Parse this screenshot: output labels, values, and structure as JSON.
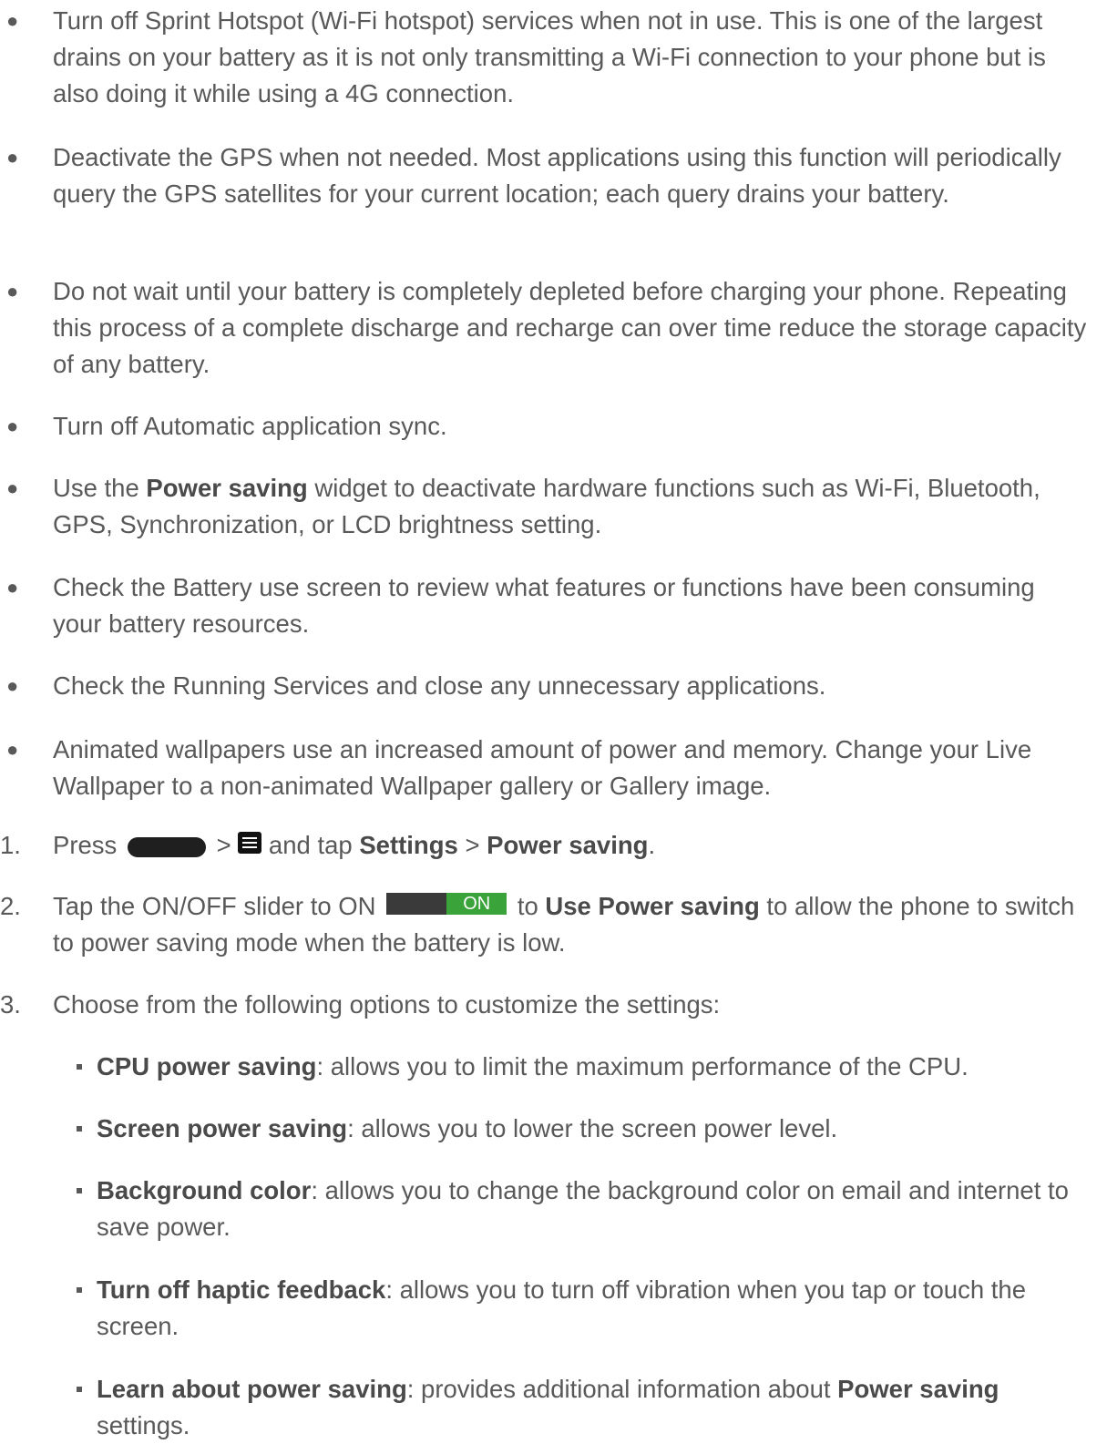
{
  "bullets": [
    "Turn off Sprint Hotspot (Wi-Fi hotspot) services when not in use. This is one of the largest drains on your battery as it is not only transmitting a Wi-Fi connection to your phone but is also doing it while using a 4G connection.",
    "Deactivate the GPS when not needed. Most applications using this function will periodically query the GPS satellites for your current location; each query drains your battery.",
    "Do not wait until your battery is completely depleted before charging your phone. Repeating this process of a complete discharge and recharge can over time reduce the storage capacity of any battery.",
    "Turn off Automatic application sync.",
    {
      "pre": "Use the ",
      "bold": "Power saving",
      "post": " widget to deactivate hardware functions such as Wi-Fi, Bluetooth, GPS, Synchronization, or LCD brightness setting."
    },
    "Check the Battery use screen to review what features or functions have been consuming your battery resources.",
    "Check the Running Services and close any unnecessary applications.",
    "Animated wallpapers use an increased amount of power and memory. Change your Live Wallpaper to a non-animated Wallpaper gallery or Gallery image."
  ],
  "bullet_glyph": "●",
  "steps": {
    "s1": {
      "num": "1.",
      "press": "Press",
      "gt1": ">",
      "and_tap": "and tap",
      "settings": "Settings",
      "gt2": ">",
      "power_saving": "Power saving",
      "end": "."
    },
    "s2": {
      "num": "2.",
      "pre": "Tap the ON/OFF slider to ON",
      "toggle_label": "ON",
      "to": "to",
      "bold": "Use Power saving",
      "post": "to allow the phone to switch to power saving mode when the battery is low."
    },
    "s3": {
      "num": "3.",
      "text": "Choose from the following options to customize the settings:"
    }
  },
  "options": [
    {
      "bold": "CPU power saving",
      "text": ": allows you to limit the maximum performance of the CPU."
    },
    {
      "bold": "Screen power saving",
      "text": ": allows you to lower the screen power level."
    },
    {
      "bold": "Background color",
      "text": ": allows you to change the background color on email and internet to save power."
    },
    {
      "bold": "Turn off haptic feedback",
      "text": ": allows you to turn off vibration when you tap or touch the screen."
    },
    {
      "bold": "Learn about power saving",
      "text": ": provides additional information about ",
      "bold2": "Power saving",
      "text2": " settings."
    }
  ],
  "icons": {
    "home": "home-key-icon",
    "menu": "menu-key-icon",
    "toggle": "on-off-slider-icon",
    "square_bullet": "square-bullet-icon"
  },
  "colors": {
    "text": "#595959",
    "toggle_on": "#3aa33a",
    "toggle_off": "#3a3a3a"
  }
}
